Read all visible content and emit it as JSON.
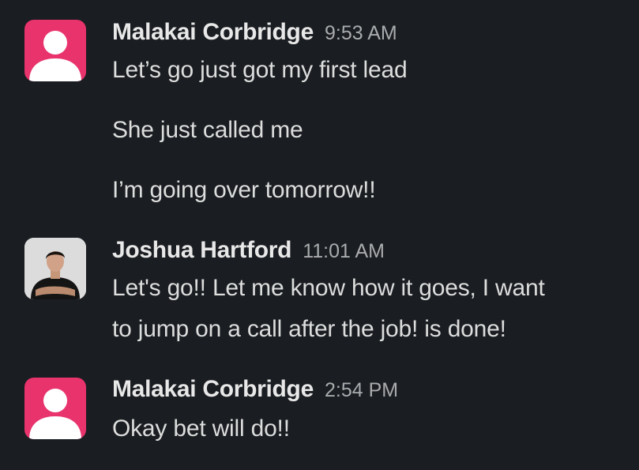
{
  "messages": [
    {
      "author": "Malakai Corbridge",
      "time": "9:53 AM",
      "avatar": "default-user-icon",
      "avatar_color": "#e8336d",
      "lines": [
        "Let’s go just got my first lead",
        "She just called me",
        "I’m going over tomorrow!!"
      ]
    },
    {
      "author": "Joshua Hartford",
      "time": "11:01 AM",
      "avatar": "user-photo",
      "lines": [
        "Let's go!! Let me know how it goes, I want",
        "to jump on a call after the job! is done!"
      ]
    },
    {
      "author": "Malakai Corbridge",
      "time": "2:54 PM",
      "avatar": "default-user-icon",
      "avatar_color": "#e8336d",
      "lines": [
        "Okay bet will do!!"
      ]
    }
  ],
  "colors": {
    "background": "#1a1d21",
    "author": "#e8e8e8",
    "timestamp": "#a9abad",
    "text": "#dcdddd"
  }
}
